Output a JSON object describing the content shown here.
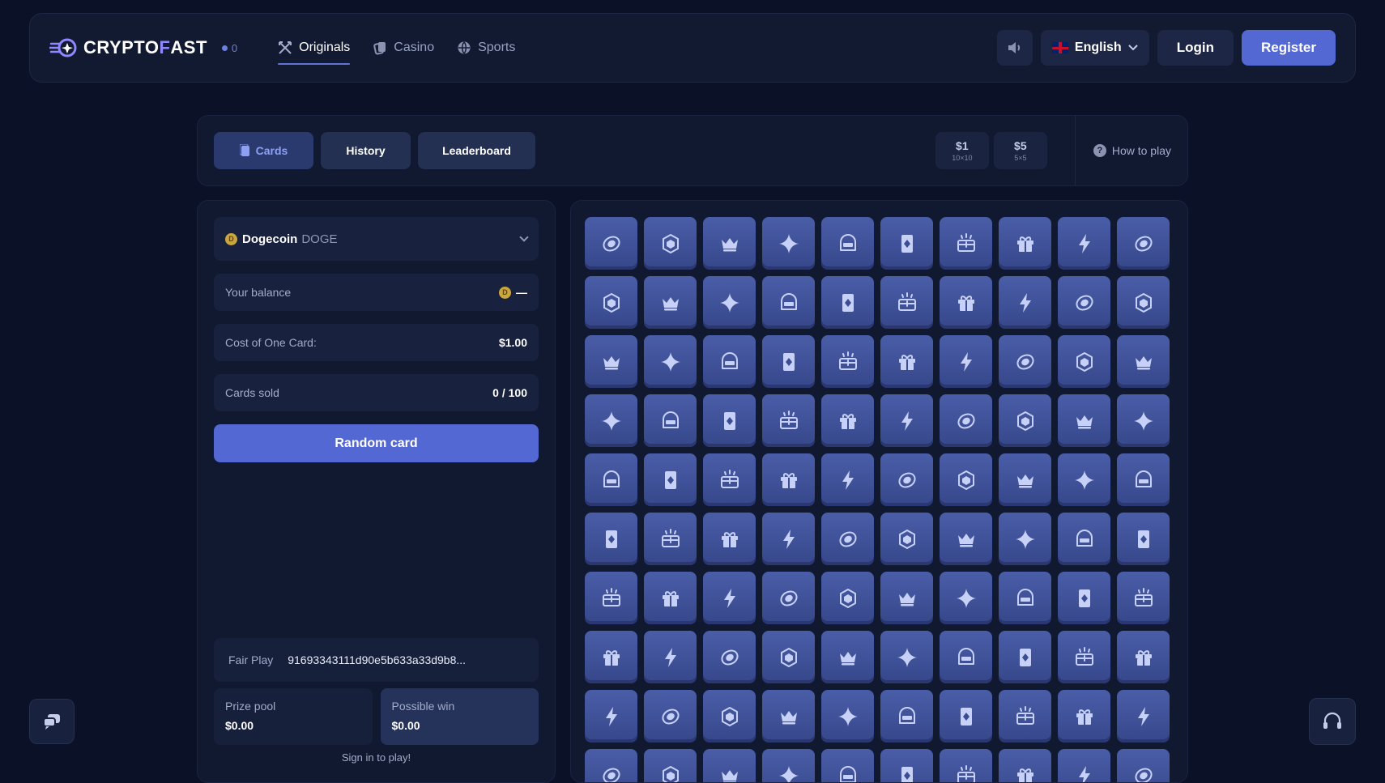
{
  "header": {
    "logo_left": "CRYPTO",
    "logo_accent": "F",
    "logo_right": "AST",
    "online_count": "0",
    "nav": [
      {
        "label": "Originals",
        "icon": "swords-icon"
      },
      {
        "label": "Casino",
        "icon": "cards-icon"
      },
      {
        "label": "Sports",
        "icon": "ball-icon"
      }
    ],
    "language": "English",
    "login": "Login",
    "register": "Register"
  },
  "tabs": [
    {
      "label": "Cards"
    },
    {
      "label": "History"
    },
    {
      "label": "Leaderboard"
    }
  ],
  "modes": [
    {
      "price": "$1",
      "size": "10×10"
    },
    {
      "price": "$5",
      "size": "5×5"
    }
  ],
  "how_to_play": "How to play",
  "panel": {
    "currency_name": "Dogecoin",
    "currency_symbol": "DOGE",
    "balance_label": "Your balance",
    "balance_value": "—",
    "cost_label": "Cost of One Card:",
    "cost_value": "$1.00",
    "sold_label": "Cards sold",
    "sold_value": "0 / 100",
    "random_button": "Random card",
    "fair_label": "Fair Play",
    "fair_hash": "91693343111d90e5b633a33d9b8...",
    "prize_label": "Prize pool",
    "prize_value": "$0.00",
    "win_label": "Possible win",
    "win_value": "$0.00",
    "signin": "Sign in to play!"
  },
  "colors": {
    "accent": "#5468d4",
    "card": "#4a5da8",
    "bg": "#0b1126"
  },
  "grid": {
    "columns": 10,
    "icon_cycle": [
      "coin-icon",
      "hexagon-icon",
      "crown-icon",
      "sparkle-icon",
      "slot-machine-icon",
      "diamond-card-icon",
      "treasure-chest-icon",
      "gift-icon",
      "lightning-icon"
    ]
  }
}
